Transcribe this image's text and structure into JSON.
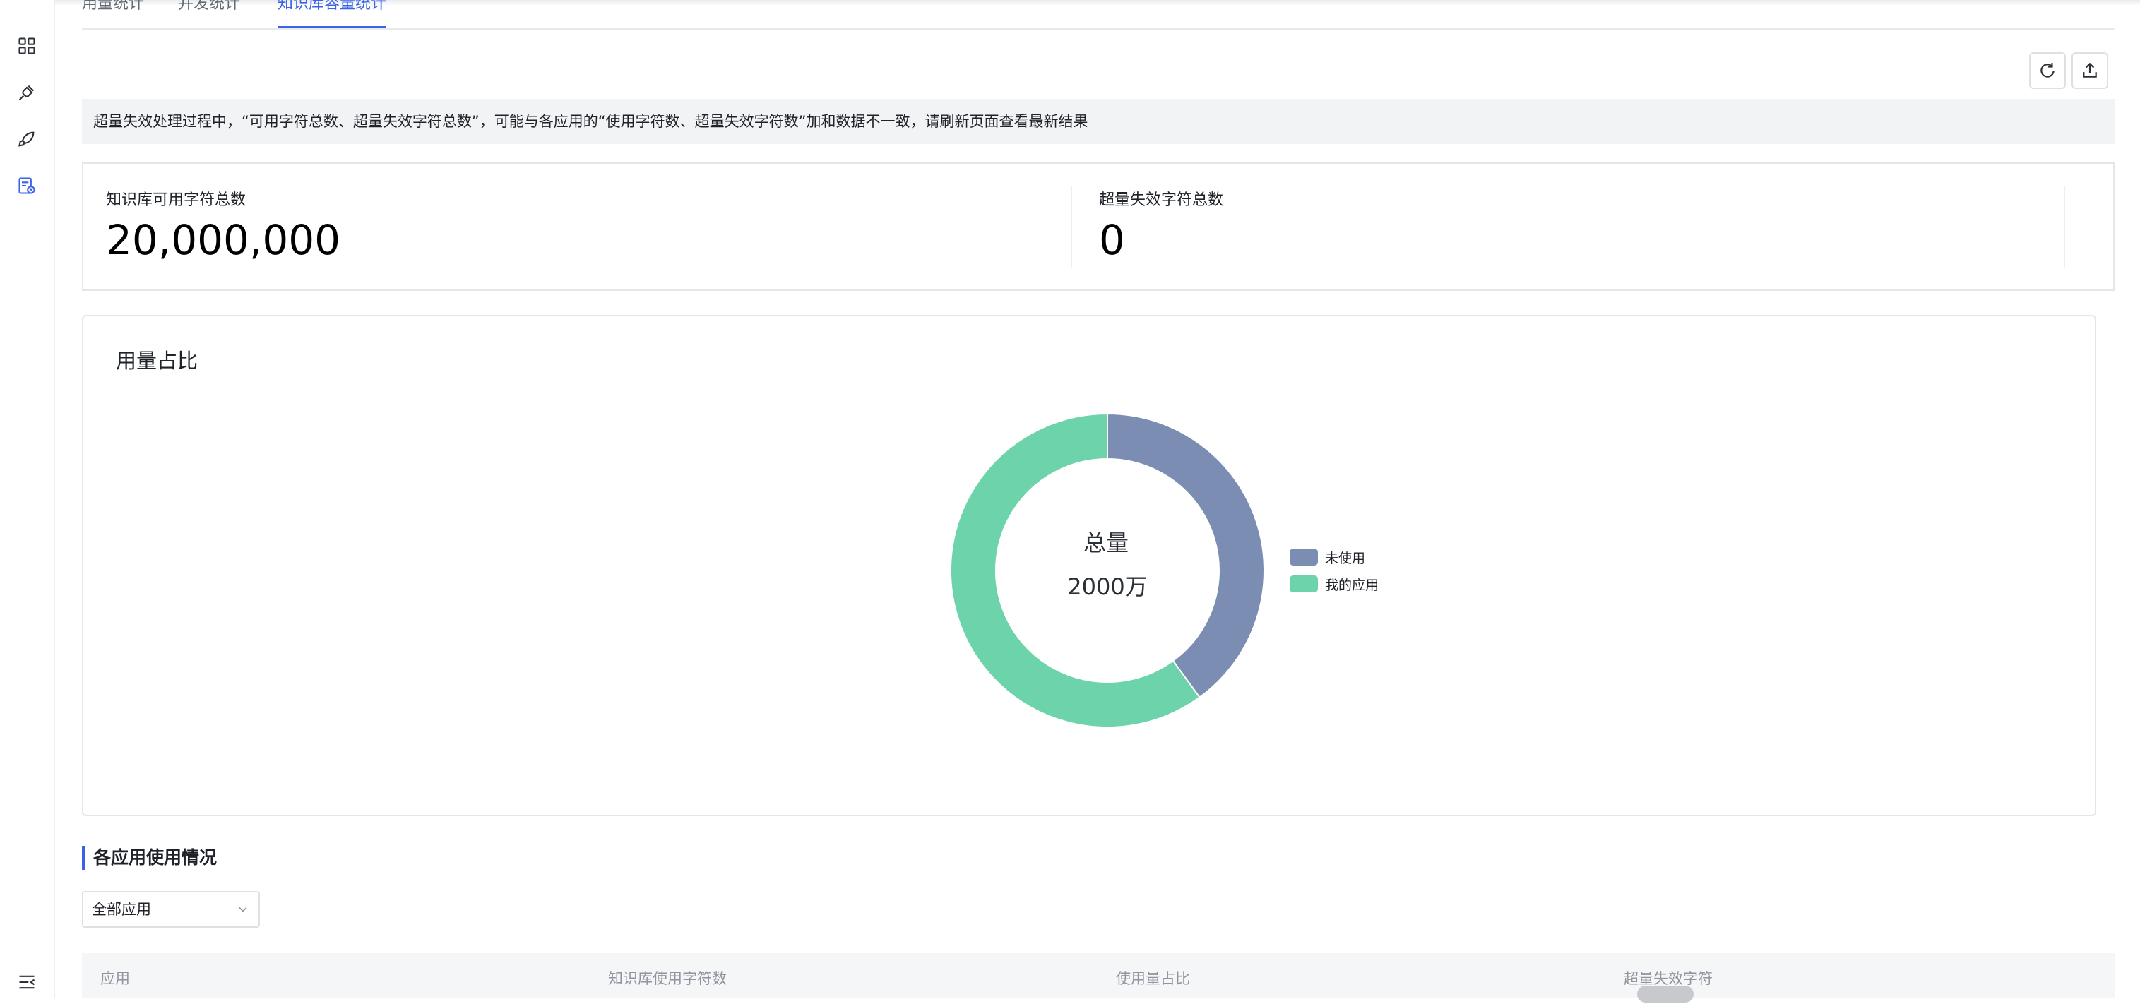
{
  "tabs": [
    {
      "label": "用量统计"
    },
    {
      "label": "并发统计"
    },
    {
      "label": "知识库容量统计"
    }
  ],
  "notice": "超量失效处理过程中，“可用字符总数、超量失效字符总数”，可能与各应用的“使用字符数、超量失效字符数”加和数据不一致，请刷新页面查看最新结果",
  "stats": [
    {
      "label": "知识库可用字符总数",
      "value": "20,000,000"
    },
    {
      "label": "超量失效字符总数",
      "value": "0"
    }
  ],
  "chart_card": {
    "title": "用量占比",
    "center_label": "总量",
    "center_value": "2000万"
  },
  "chart_data": {
    "type": "pie",
    "categories": [
      "未使用",
      "我的应用"
    ],
    "values": [
      40,
      60
    ],
    "colors": [
      "#7b8db3",
      "#6dd3aa"
    ],
    "legend_position": "right"
  },
  "section": {
    "title": "各应用使用情况",
    "select_value": "全部应用"
  },
  "table": {
    "columns": [
      "应用",
      "知识库使用字符数",
      "使用量占比",
      "超量失效字符"
    ]
  },
  "icons": {
    "rail": [
      "grid-icon",
      "plug-icon",
      "rocket-icon",
      "document-stats-icon",
      "collapse-menu-icon"
    ],
    "toolbar": [
      "refresh-icon",
      "export-icon"
    ]
  }
}
